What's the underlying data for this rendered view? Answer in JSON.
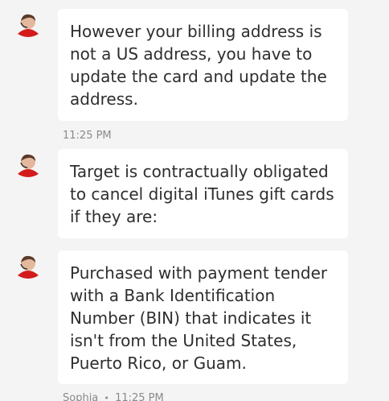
{
  "agent": {
    "name": "Sophia"
  },
  "messages": [
    {
      "text": "However your billing address is not a US address, you have to update the card and update the address.",
      "time": "11:25 PM"
    },
    {
      "text": "Target is contractually obligated to cancel digital iTunes gift cards if they are:"
    },
    {
      "text": "Purchased with payment tender with a Bank Identification Number (BIN) that indicates it isn't from the United States, Puerto Rico, or Guam.",
      "time": "11:25 PM"
    }
  ],
  "separator": "•",
  "colors": {
    "avatar_shirt": "#d31b1b",
    "bubble": "#ffffff",
    "background": "#f4f4f4"
  },
  "icons": {
    "avatar": "agent-avatar-icon"
  }
}
